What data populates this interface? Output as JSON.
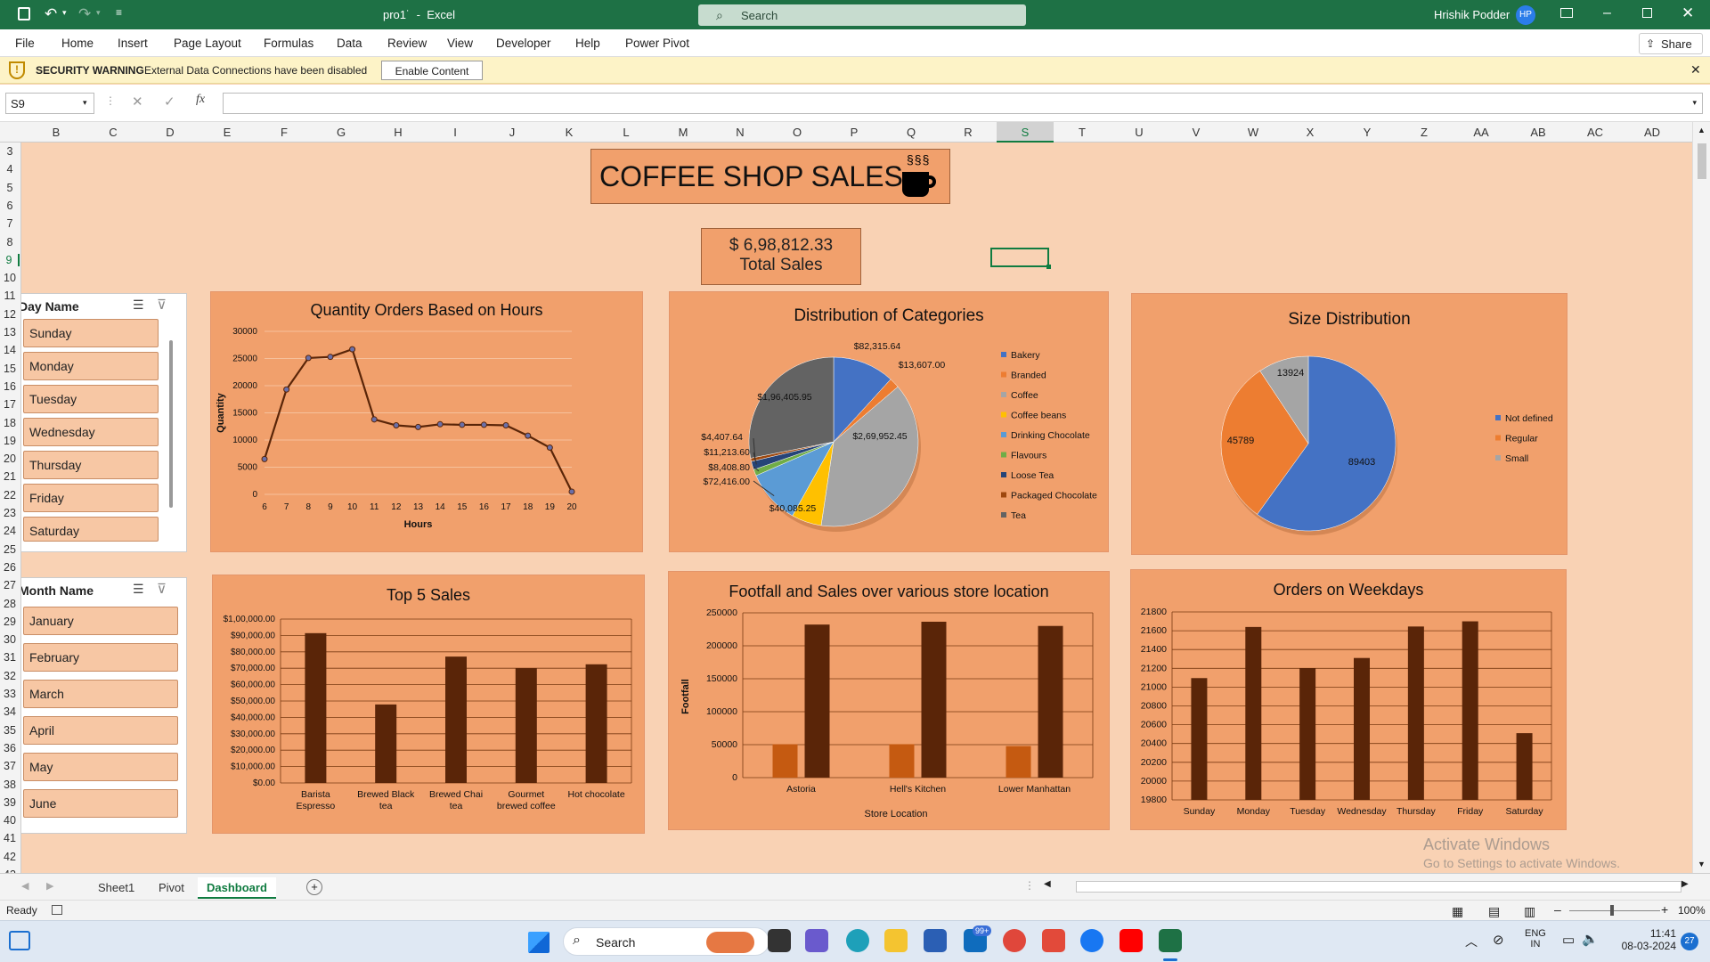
{
  "window": {
    "file_title": "pro1",
    "dirty_marker": "˙",
    "separator": "-",
    "app_name": "Excel",
    "user_name": "Hrishik Podder",
    "user_initials": "HP"
  },
  "search": {
    "placeholder": "Search"
  },
  "menu": [
    "File",
    "Home",
    "Insert",
    "Page Layout",
    "Formulas",
    "Data",
    "Review",
    "View",
    "Developer",
    "Help",
    "Power Pivot"
  ],
  "share_label": "Share",
  "security": {
    "title": "SECURITY WARNING",
    "message": "External Data Connections have been disabled",
    "button": "Enable Content"
  },
  "formula_bar": {
    "name_box": "S9",
    "fx": "fx",
    "value": ""
  },
  "columns": [
    "B",
    "C",
    "D",
    "E",
    "F",
    "G",
    "H",
    "I",
    "J",
    "K",
    "L",
    "M",
    "N",
    "O",
    "P",
    "Q",
    "R",
    "S",
    "T",
    "U",
    "V",
    "W",
    "X",
    "Y",
    "Z",
    "AA",
    "AB",
    "AC",
    "AD"
  ],
  "selected_column": "S",
  "rows": [
    "3",
    "4",
    "5",
    "6",
    "7",
    "8",
    "9",
    "10",
    "11",
    "12",
    "13",
    "14",
    "15",
    "16",
    "17",
    "18",
    "19",
    "20",
    "21",
    "22",
    "23",
    "24",
    "25",
    "26",
    "27",
    "28",
    "29",
    "30",
    "31",
    "32",
    "33",
    "34",
    "35",
    "36",
    "37",
    "38",
    "39",
    "40",
    "41",
    "42",
    "43"
  ],
  "selected_row": "9",
  "dashboard": {
    "title": "COFFEE SHOP SALES",
    "total_sales_value": "$ 6,98,812.33",
    "total_sales_label": "Total Sales"
  },
  "slicers": {
    "day": {
      "header": "Day Name",
      "items": [
        "Sunday",
        "Monday",
        "Tuesday",
        "Wednesday",
        "Thursday",
        "Friday",
        "Saturday"
      ]
    },
    "month": {
      "header": "Month Name",
      "items": [
        "January",
        "February",
        "March",
        "April",
        "May",
        "June"
      ]
    }
  },
  "chart_data": [
    {
      "id": "hours",
      "type": "line",
      "title": "Quantity Orders Based on Hours",
      "xlabel": "Hours",
      "ylabel": "Quantity",
      "x": [
        6,
        7,
        8,
        9,
        10,
        11,
        12,
        13,
        14,
        15,
        16,
        17,
        18,
        19,
        20
      ],
      "values": [
        6500,
        19300,
        25100,
        25300,
        26700,
        13800,
        12700,
        12400,
        12900,
        12800,
        12800,
        12700,
        10800,
        8600,
        500
      ],
      "ylim": [
        0,
        30000
      ],
      "yticks": [
        "30000",
        "25000",
        "20000",
        "15000",
        "10000",
        "5000",
        "0"
      ],
      "grid": true
    },
    {
      "id": "categories",
      "type": "pie",
      "title": "Distribution of Categories",
      "categories": [
        "Bakery",
        "Branded",
        "Coffee",
        "Coffee beans",
        "Drinking Chocolate",
        "Flavours",
        "Loose Tea",
        "Packaged Chocolate",
        "Tea"
      ],
      "values": [
        82315.64,
        13607.0,
        269952.45,
        40085.25,
        72416.0,
        8408.8,
        11213.6,
        4407.64,
        196405.95
      ],
      "labels": [
        "$82,315.64",
        "$13,607.00",
        "$2,69,952.45",
        "$40,085.25",
        "$72,416.00",
        "$8,408.80",
        "$11,213.60",
        "$4,407.64",
        "$1,96,405.95"
      ],
      "colors": [
        "#4472c4",
        "#ed7d31",
        "#a5a5a5",
        "#ffc000",
        "#5b9bd5",
        "#70ad47",
        "#264478",
        "#9e480e",
        "#636363"
      ],
      "legend": "right"
    },
    {
      "id": "size",
      "type": "pie",
      "title": "Size Distribution",
      "categories": [
        "Not defined",
        "Regular",
        "Small"
      ],
      "values": [
        89403,
        45789,
        13924
      ],
      "labels": [
        "89403",
        "45789",
        "13924"
      ],
      "colors": [
        "#4472c4",
        "#ed7d31",
        "#a5a5a5"
      ],
      "legend": "right"
    },
    {
      "id": "top5",
      "type": "bar",
      "title": "Top 5 Sales",
      "categories": [
        "Barista Espresso",
        "Brewed Black tea",
        "Brewed Chai tea",
        "Gourmet brewed coffee",
        "Hot chocolate"
      ],
      "category_lines": [
        [
          "Barista",
          "Espresso"
        ],
        [
          "Brewed Black",
          "tea"
        ],
        [
          "Brewed Chai",
          "tea"
        ],
        [
          "Gourmet",
          "brewed coffee"
        ],
        [
          "Hot chocolate"
        ]
      ],
      "values": [
        91400,
        47900,
        77100,
        70000,
        72400
      ],
      "ylim": [
        0,
        100000
      ],
      "yticks": [
        "$1,00,000.00",
        "$90,000.00",
        "$80,000.00",
        "$70,000.00",
        "$60,000.00",
        "$50,000.00",
        "$40,000.00",
        "$30,000.00",
        "$20,000.00",
        "$10,000.00",
        "$0.00"
      ],
      "grid": true
    },
    {
      "id": "footfall",
      "type": "bar",
      "title": "Footfall and Sales over various store location",
      "xlabel": "Store Location",
      "ylabel": "Footfall",
      "categories": [
        "Astoria",
        "Hell's Kitchen",
        "Lower Manhattan"
      ],
      "series": [
        {
          "values": [
            50600,
            50700,
            47800
          ],
          "color": "#c55a11"
        },
        {
          "values": [
            232200,
            236500,
            230100
          ],
          "color": "#5a2508"
        }
      ],
      "ylim": [
        0,
        250000
      ],
      "yticks": [
        "250000",
        "200000",
        "150000",
        "100000",
        "50000",
        "0"
      ],
      "grid": true
    },
    {
      "id": "weekdays",
      "type": "bar",
      "title": "Orders on Weekdays",
      "categories": [
        "Sunday",
        "Monday",
        "Tuesday",
        "Wednesday",
        "Thursday",
        "Friday",
        "Saturday"
      ],
      "values": [
        21096,
        21640,
        21202,
        21310,
        21645,
        21700,
        20510
      ],
      "ylim": [
        19800,
        21800
      ],
      "yticks": [
        "21800",
        "21600",
        "21400",
        "21200",
        "21000",
        "20800",
        "20600",
        "20400",
        "20200",
        "20000",
        "19800"
      ],
      "grid": true
    }
  ],
  "watermark": {
    "line1": "Activate Windows",
    "line2": "Go to Settings to activate Windows."
  },
  "sheet_tabs": [
    "Sheet1",
    "Pivot",
    "Dashboard"
  ],
  "active_tab": "Dashboard",
  "status": {
    "ready": "Ready",
    "zoom": "100%"
  },
  "taskbar": {
    "search": "Search",
    "lang1": "ENG",
    "lang2": "IN",
    "time": "11:41",
    "date": "08-03-2024",
    "mail_badge": "99+",
    "notif_count": "27"
  }
}
